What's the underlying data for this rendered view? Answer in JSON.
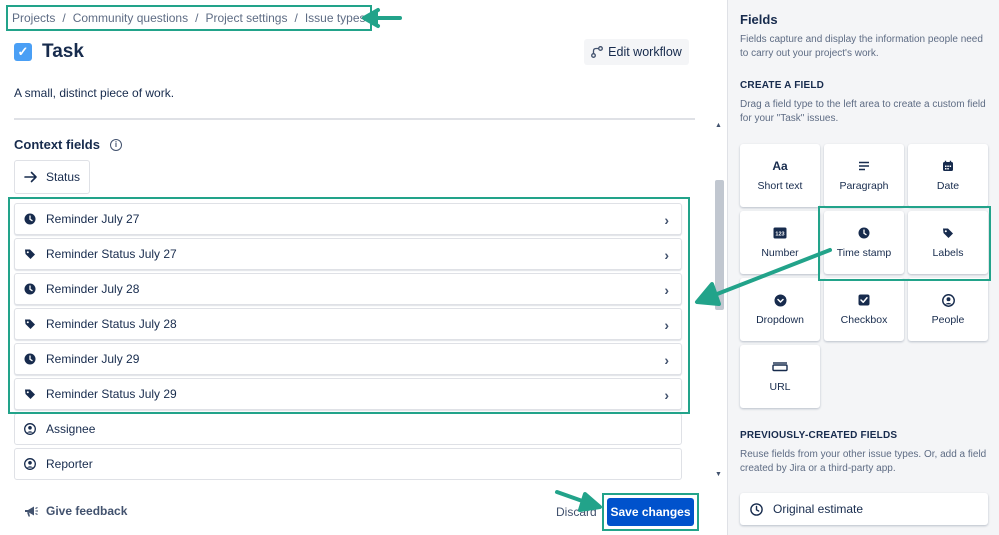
{
  "breadcrumb": {
    "items": [
      "Projects",
      "Community questions",
      "Project settings",
      "Issue types"
    ],
    "separator": "/"
  },
  "header": {
    "title": "Task",
    "edit_workflow_label": "Edit workflow"
  },
  "description": "A small, distinct piece of work.",
  "context": {
    "heading": "Context fields",
    "status_label": "Status"
  },
  "fields": [
    {
      "label": "Reminder July 27",
      "icon": "clock-icon"
    },
    {
      "label": "Reminder Status July 27",
      "icon": "tag-icon"
    },
    {
      "label": "Reminder July 28",
      "icon": "clock-icon"
    },
    {
      "label": "Reminder Status July 28",
      "icon": "tag-icon"
    },
    {
      "label": "Reminder July 29",
      "icon": "clock-icon"
    },
    {
      "label": "Reminder Status July 29",
      "icon": "tag-icon"
    },
    {
      "label": "Assignee",
      "icon": "person-icon"
    },
    {
      "label": "Reporter",
      "icon": "person-icon"
    }
  ],
  "footer": {
    "feedback_label": "Give feedback",
    "discard_label": "Discard",
    "save_label": "Save changes"
  },
  "sidebar": {
    "title": "Fields",
    "description": "Fields capture and display the information people need to carry out your project's work.",
    "create_heading": "CREATE A FIELD",
    "create_desc": "Drag a field type to the left area to create a custom field for your \"Task\" issues.",
    "tiles": [
      {
        "label": "Short text",
        "icon": "text-aa-icon",
        "glyph": "Aa"
      },
      {
        "label": "Paragraph",
        "icon": "paragraph-icon",
        "glyph": "≡"
      },
      {
        "label": "Date",
        "icon": "calendar-icon",
        "glyph": "▦"
      },
      {
        "label": "Number",
        "icon": "number-icon",
        "glyph": "123"
      },
      {
        "label": "Time stamp",
        "icon": "clock-icon",
        "glyph": ""
      },
      {
        "label": "Labels",
        "icon": "tag-icon",
        "glyph": ""
      },
      {
        "label": "Dropdown",
        "icon": "dropdown-icon",
        "glyph": ""
      },
      {
        "label": "Checkbox",
        "icon": "checkbox-icon",
        "glyph": "✓"
      },
      {
        "label": "People",
        "icon": "person-icon",
        "glyph": ""
      },
      {
        "label": "URL",
        "icon": "link-icon",
        "glyph": ""
      }
    ],
    "previous_heading": "PREVIOUSLY-CREATED FIELDS",
    "previous_desc": "Reuse fields from your other issue types. Or, add a field created by Jira or a third-party app.",
    "previous_fields": [
      {
        "label": "Original estimate",
        "icon": "clock-outline-icon"
      }
    ]
  },
  "colors": {
    "accent": "#0052cc",
    "annotation": "#22a38a",
    "sidebar_bg": "#f4f5f7"
  }
}
